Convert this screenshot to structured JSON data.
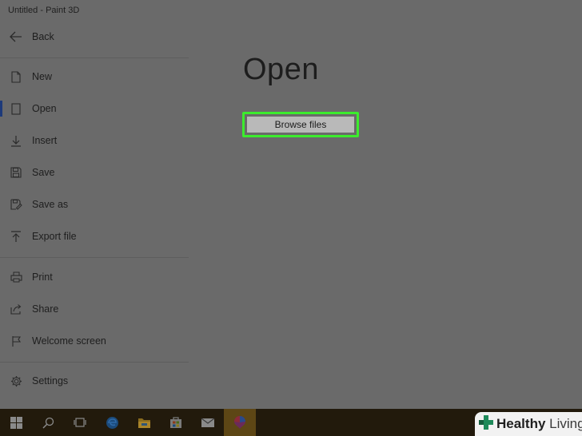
{
  "window": {
    "title": "Untitled - Paint 3D"
  },
  "back": {
    "label": "Back",
    "icon": "arrow-left-icon"
  },
  "nav": {
    "items": [
      {
        "label": "New",
        "icon": "new-file-icon"
      },
      {
        "label": "Open",
        "icon": "open-file-icon",
        "active": true
      },
      {
        "label": "Insert",
        "icon": "insert-icon"
      },
      {
        "label": "Save",
        "icon": "save-icon"
      },
      {
        "label": "Save as",
        "icon": "save-as-icon"
      },
      {
        "label": "Export file",
        "icon": "export-icon"
      },
      {
        "label": "Print",
        "icon": "print-icon"
      },
      {
        "label": "Share",
        "icon": "share-icon"
      },
      {
        "label": "Welcome screen",
        "icon": "flag-icon"
      },
      {
        "label": "Settings",
        "icon": "gear-icon"
      }
    ]
  },
  "main": {
    "title": "Open",
    "browse_label": "Browse files"
  },
  "taskbar": {
    "items": [
      "windows-start-icon",
      "search-icon",
      "task-view-icon",
      "edge-icon",
      "file-explorer-icon",
      "store-icon",
      "mail-icon",
      "paint3d-icon"
    ]
  },
  "watermark": {
    "text_a": "Healthy",
    "text_b": " Living"
  },
  "colors": {
    "highlight": "#3cec2d",
    "active_bar": "#1d3a7a",
    "taskbar_active": "#5d4615"
  }
}
